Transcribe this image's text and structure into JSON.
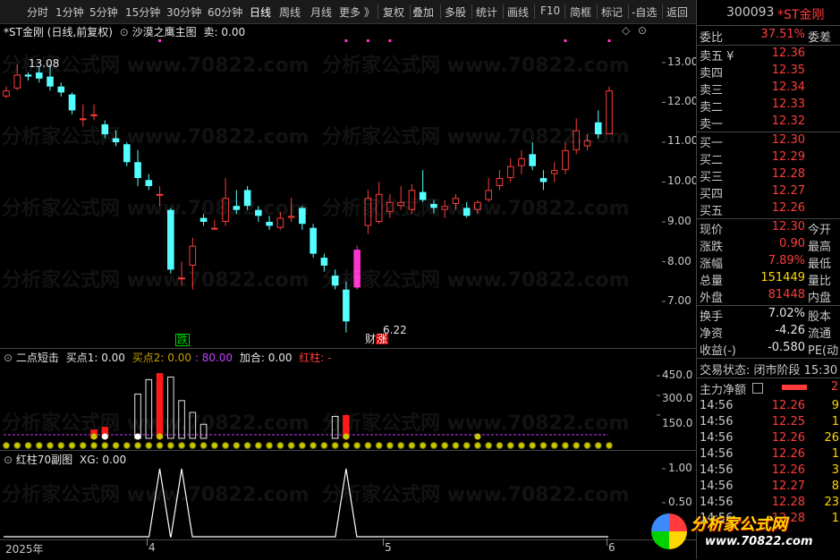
{
  "toolbar": {
    "items": [
      "分时",
      "1分钟",
      "5分钟",
      "15分钟",
      "30分钟",
      "60分钟",
      "日线",
      "周线",
      "月线",
      "更多 》",
      "复权",
      "叠加",
      "多股",
      "统计",
      "画线",
      "F10",
      "简框",
      "标记",
      "-自选",
      "返回"
    ]
  },
  "main": {
    "title": "*ST金刚 (日线,前复权)",
    "indicator": "沙漠之鹰主图",
    "sell_label": "卖: 0.00",
    "price_axis": [
      "13.00",
      "12.00",
      "11.00",
      "10.00",
      "9.00",
      "8.00",
      "7.00"
    ],
    "high_label": "13.08",
    "low_label": "6.22",
    "badge_fall": "跌",
    "badge_cai": "财",
    "badge_rise": "涨"
  },
  "sub1": {
    "name": "二点短击",
    "buy1": "买点1: 0.00",
    "buy2_label": "买点2:",
    "buy2_value": "0.00",
    "buy2_extra": ": 80.00",
    "add": "加合: 0.00",
    "red": "红柱: -",
    "axis": [
      "450.0",
      "300.0",
      "150.0"
    ]
  },
  "sub2": {
    "name": "红柱70副图",
    "xg": "XG: 0.00",
    "axis": [
      "1.00",
      "0.50"
    ]
  },
  "xaxis": {
    "labels": [
      "2025年",
      "4",
      "5",
      "6"
    ]
  },
  "watermark": "分析家公式网 www.70822.com",
  "logo": {
    "title": "分析家公式网",
    "url": "www.70822.com"
  },
  "quote": {
    "code": "300093",
    "name": "*ST金刚",
    "weibi_label": "委比",
    "weibi_value": "37.51%",
    "weibi_tail": "委差",
    "asks": [
      {
        "label": "卖五 ¥",
        "price": "12.36"
      },
      {
        "label": "卖四",
        "price": "12.35"
      },
      {
        "label": "卖三",
        "price": "12.34"
      },
      {
        "label": "卖二",
        "price": "12.33"
      },
      {
        "label": "卖一",
        "price": "12.32"
      }
    ],
    "bids": [
      {
        "label": "买一",
        "price": "12.30"
      },
      {
        "label": "买二",
        "price": "12.29"
      },
      {
        "label": "买三",
        "price": "12.28"
      },
      {
        "label": "买四",
        "price": "12.27"
      },
      {
        "label": "买五",
        "price": "12.26"
      }
    ],
    "stats": [
      {
        "label": "现价",
        "value": "12.30",
        "tail": "今开",
        "color": "red"
      },
      {
        "label": "涨跌",
        "value": "0.90",
        "tail": "最高",
        "color": "red"
      },
      {
        "label": "涨幅",
        "value": "7.89%",
        "tail": "最低",
        "color": "red"
      },
      {
        "label": "总量",
        "value": "151449",
        "tail": "量比",
        "color": "yellow"
      },
      {
        "label": "外盘",
        "value": "81448",
        "tail": "内盘",
        "color": "red"
      }
    ],
    "stats2": [
      {
        "label": "换手",
        "value": "7.02%",
        "tail": "股本"
      },
      {
        "label": "净资",
        "value": "-4.26",
        "tail": "流通"
      },
      {
        "label": "收益(-)",
        "value": "-0.580",
        "tail": "PE(动"
      }
    ],
    "status": "交易状态: 闭市阶段 15:30",
    "net_label": "主力净额",
    "net_tail": "2",
    "ticks": [
      {
        "time": "14:56",
        "price": "12.26",
        "vol": "9"
      },
      {
        "time": "14:56",
        "price": "12.25",
        "vol": "1"
      },
      {
        "time": "14:56",
        "price": "12.26",
        "vol": "26"
      },
      {
        "time": "14:56",
        "price": "12.26",
        "vol": "1"
      },
      {
        "time": "14:56",
        "price": "12.26",
        "vol": "3"
      },
      {
        "time": "14:56",
        "price": "12.27",
        "vol": "8"
      },
      {
        "time": "14:56",
        "price": "12.28",
        "vol": "23"
      },
      {
        "time": "14:56",
        "price": "12.28",
        "vol": "1"
      }
    ]
  },
  "chart_data": {
    "type": "candlestick",
    "ylim": [
      6.0,
      13.5
    ],
    "candles": [
      [
        12.15,
        12.3,
        12.4,
        12.1
      ],
      [
        12.35,
        12.7,
        12.95,
        12.3
      ],
      [
        12.7,
        12.65,
        12.75,
        12.55
      ],
      [
        12.75,
        12.6,
        12.9,
        12.5
      ],
      [
        12.65,
        12.4,
        12.95,
        12.3
      ],
      [
        12.4,
        12.25,
        12.5,
        12.15
      ],
      [
        12.2,
        11.8,
        12.25,
        11.7
      ],
      [
        11.6,
        11.6,
        11.95,
        11.4
      ],
      [
        11.7,
        11.7,
        11.95,
        11.55
      ],
      [
        11.45,
        11.2,
        11.55,
        11.1
      ],
      [
        11.1,
        11.0,
        11.3,
        10.9
      ],
      [
        10.95,
        10.5,
        11.0,
        10.4
      ],
      [
        10.5,
        10.1,
        10.8,
        9.9
      ],
      [
        10.05,
        9.9,
        10.2,
        9.8
      ],
      [
        9.7,
        9.7,
        9.9,
        9.4
      ],
      [
        9.3,
        7.8,
        9.35,
        7.7
      ],
      [
        7.6,
        7.6,
        8.0,
        7.4
      ],
      [
        7.9,
        8.4,
        8.6,
        7.3
      ],
      [
        9.1,
        9.0,
        9.2,
        8.9
      ],
      [
        8.85,
        8.85,
        9.05,
        8.8
      ],
      [
        9.0,
        9.6,
        10.1,
        8.9
      ],
      [
        9.4,
        9.3,
        9.8,
        9.2
      ],
      [
        9.8,
        9.4,
        9.9,
        9.3
      ],
      [
        9.3,
        9.15,
        9.4,
        9.0
      ],
      [
        9.0,
        8.9,
        9.15,
        8.8
      ],
      [
        8.85,
        9.1,
        9.25,
        8.8
      ],
      [
        9.1,
        9.15,
        9.6,
        9.0
      ],
      [
        9.35,
        8.95,
        9.4,
        8.8
      ],
      [
        8.85,
        8.2,
        8.95,
        8.1
      ],
      [
        8.1,
        7.9,
        8.2,
        7.75
      ],
      [
        7.65,
        7.4,
        7.8,
        7.3
      ],
      [
        7.3,
        6.5,
        7.5,
        6.22
      ],
      [
        7.35,
        8.3,
        8.4,
        7.3
      ],
      [
        8.9,
        9.6,
        9.8,
        8.7
      ],
      [
        9.0,
        9.7,
        10.0,
        8.95
      ],
      [
        9.25,
        9.5,
        9.7,
        9.1
      ],
      [
        9.4,
        9.5,
        9.9,
        9.3
      ],
      [
        9.3,
        9.8,
        9.95,
        9.2
      ],
      [
        9.75,
        9.55,
        10.3,
        9.5
      ],
      [
        9.45,
        9.35,
        9.55,
        9.2
      ],
      [
        9.3,
        9.4,
        9.55,
        9.1
      ],
      [
        9.45,
        9.6,
        9.7,
        9.3
      ],
      [
        9.35,
        9.15,
        9.5,
        9.1
      ],
      [
        9.3,
        9.5,
        9.55,
        9.2
      ],
      [
        9.55,
        9.8,
        10.1,
        9.5
      ],
      [
        9.9,
        10.1,
        10.3,
        9.8
      ],
      [
        10.1,
        10.4,
        10.6,
        10.0
      ],
      [
        10.4,
        10.6,
        10.8,
        10.2
      ],
      [
        10.7,
        10.4,
        11.0,
        10.3
      ],
      [
        10.1,
        10.0,
        10.3,
        9.8
      ],
      [
        10.2,
        10.3,
        10.5,
        10.0
      ],
      [
        10.3,
        10.8,
        11.0,
        10.2
      ],
      [
        10.8,
        11.3,
        11.6,
        10.7
      ],
      [
        10.9,
        11.05,
        11.2,
        10.8
      ],
      [
        11.5,
        11.2,
        11.8,
        11.1
      ],
      [
        11.2,
        12.3,
        12.4,
        11.2
      ]
    ],
    "colors": {
      "up": "#ff3b3b",
      "down": "#54ffff",
      "special": "#ff33d1"
    },
    "sub1_bars": [
      {
        "i": 12,
        "v": 310,
        "c": "white"
      },
      {
        "i": 13,
        "v": 420,
        "c": "white"
      },
      {
        "i": 14,
        "v": 470,
        "c": "red"
      },
      {
        "i": 15,
        "v": 440,
        "c": "white"
      },
      {
        "i": 16,
        "v": 260,
        "c": "white"
      },
      {
        "i": 17,
        "v": 170,
        "c": "white"
      },
      {
        "i": 18,
        "v": 80,
        "c": "white"
      },
      {
        "i": 9,
        "v": 60,
        "c": "red"
      },
      {
        "i": 8,
        "v": 40,
        "c": "red"
      },
      {
        "i": 30,
        "v": 140,
        "c": "white"
      },
      {
        "i": 31,
        "v": 150,
        "c": "red"
      }
    ],
    "sub1_ylim": [
      0,
      500
    ],
    "sub2_peaks": [
      14,
      16,
      31
    ],
    "sub2_ylim": [
      0,
      1.2
    ]
  }
}
